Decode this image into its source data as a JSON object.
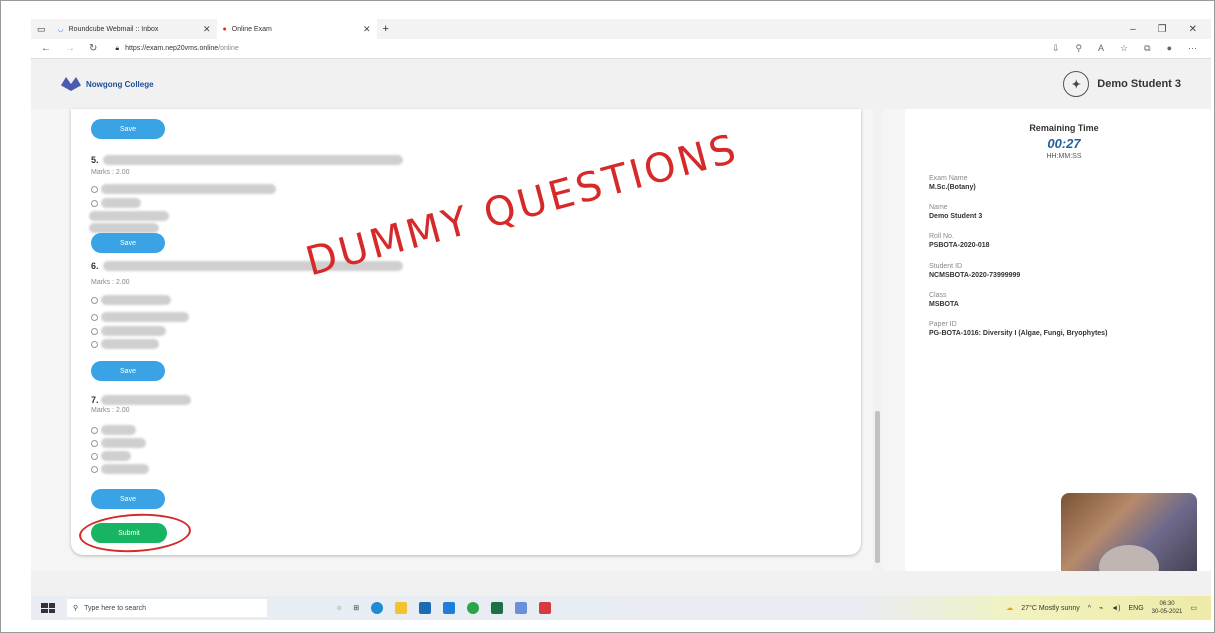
{
  "browser": {
    "tabs": [
      {
        "label": "Roundcube Webmail :: Inbox"
      },
      {
        "label": "Online Exam"
      }
    ],
    "new_tab_label": "+",
    "address": {
      "host": "https://exam.nep20vms.online",
      "path": "/online"
    }
  },
  "header": {
    "college_name": "Nowgong College",
    "user_name": "Demo Student 3"
  },
  "questions": [
    {
      "number": "5.",
      "marks": "Marks : 2.00",
      "save_label": "Save"
    },
    {
      "number": "6.",
      "marks": "Marks : 2.00",
      "save_label": "Save"
    },
    {
      "number": "7.",
      "marks": "Marks : 2.00",
      "save_label": "Save"
    }
  ],
  "top_save_label": "Save",
  "submit_label": "Submit",
  "annotation_text": "DUMMY QUESTIONS",
  "exam_info": {
    "remaining_time_title": "Remaining Time",
    "remaining_time_value": "00:27",
    "time_format": "HH:MM:SS",
    "fields": [
      {
        "label": "Exam Name",
        "value": "M.Sc.(Botany)"
      },
      {
        "label": "Name",
        "value": "Demo Student 3"
      },
      {
        "label": "Roll No.",
        "value": "PSBOTA-2020-018"
      },
      {
        "label": "Student ID",
        "value": "NCMSBOTA-2020-73999999"
      },
      {
        "label": "Class",
        "value": "MSBOTA"
      },
      {
        "label": "Paper ID",
        "value": "PG-BOTA-1016: Diversity I (Algae, Fungi, Bryophytes)"
      }
    ]
  },
  "taskbar": {
    "search_placeholder": "Type here to search",
    "weather": "27°C  Mostly sunny",
    "lang": "ENG",
    "time": "06:30",
    "date": "30-05-2021"
  },
  "colors": {
    "save_button": "#3aa3e6",
    "submit_button": "#16b463",
    "annotation": "#d62929"
  }
}
